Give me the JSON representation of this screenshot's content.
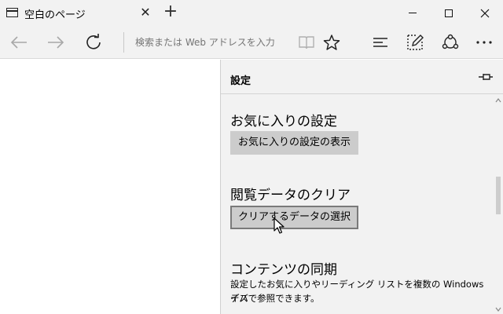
{
  "tab": {
    "title": "空白のページ",
    "close_glyph": "✕"
  },
  "new_tab_glyph": "+",
  "window_controls": [
    "minimize-icon",
    "maximize-icon",
    "close-icon"
  ],
  "toolbar": {
    "address_placeholder": "検索または Web アドレスを入力",
    "icons": [
      "back-arrow-icon",
      "forward-arrow-icon",
      "refresh-icon",
      "reading-view-icon",
      "favorite-star-icon",
      "hub-icon",
      "web-note-icon",
      "share-icon",
      "more-icon"
    ]
  },
  "settings": {
    "title": "設定",
    "favorites": {
      "heading": "お気に入りの設定",
      "button": "お気に入りの設定の表示"
    },
    "clear_data": {
      "heading": "閲覧データのクリア",
      "button": "クリアするデータの選択"
    },
    "sync": {
      "heading": "コンテンツの同期",
      "description_line1": "設定したお気に入りやリーディング リストを複数の Windows デバ",
      "description_line2": "イスで参照できます。"
    }
  },
  "colors": {
    "chrome": "#f2f2f2",
    "button": "#cccccc",
    "focus_border": "#7a7a7a"
  }
}
